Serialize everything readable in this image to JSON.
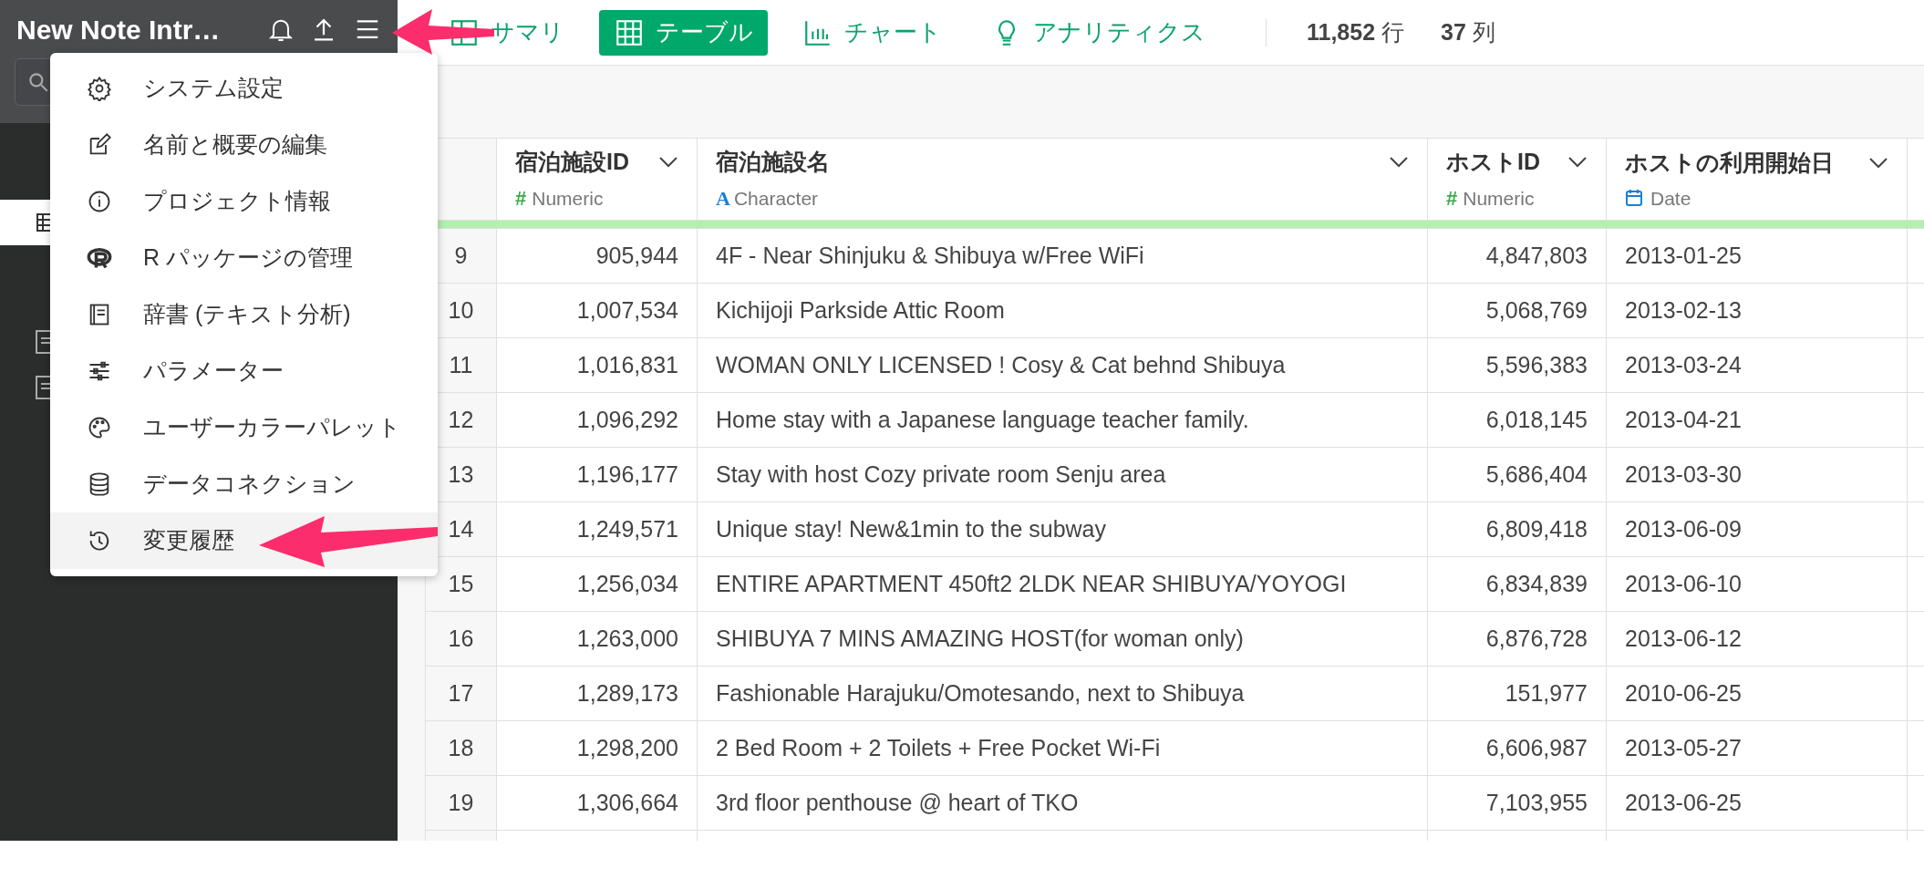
{
  "sidebar": {
    "title": "New Note Intr…"
  },
  "menu": {
    "items": [
      {
        "kind": "gear",
        "label": "システム設定",
        "selected": false
      },
      {
        "kind": "edit",
        "label": "名前と概要の編集",
        "selected": false
      },
      {
        "kind": "info",
        "label": "プロジェクト情報",
        "selected": false
      },
      {
        "kind": "r",
        "label": "R パッケージの管理",
        "selected": false
      },
      {
        "kind": "book",
        "label": "辞書 (テキスト分析)",
        "selected": false
      },
      {
        "kind": "sliders",
        "label": "パラメーター",
        "selected": false
      },
      {
        "kind": "palette",
        "label": "ユーザーカラーパレット",
        "selected": false
      },
      {
        "kind": "database",
        "label": "データコネクション",
        "selected": false
      },
      {
        "kind": "history",
        "label": "変更履歴",
        "selected": true
      }
    ]
  },
  "tabs": [
    {
      "kind": "summary",
      "label": "サマリ",
      "selected": false
    },
    {
      "kind": "table",
      "label": "テーブル",
      "selected": true
    },
    {
      "kind": "chart",
      "label": "チャート",
      "selected": false
    },
    {
      "kind": "analytics",
      "label": "アナリティクス",
      "selected": false
    }
  ],
  "counts": [
    "**11,852** 行",
    "**37** 列"
  ],
  "table": {
    "columns": [
      {
        "name": "宿泊施設ID",
        "kind": "numeric",
        "symbol": "#",
        "type": "Numeric"
      },
      {
        "name": "宿泊施設名",
        "kind": "character",
        "symbol": "A",
        "type": "Character"
      },
      {
        "name": "ホストID",
        "kind": "numeric",
        "symbol": "#",
        "type": "Numeric"
      },
      {
        "name": "ホストの利用開始日",
        "kind": "date",
        "type": "Date"
      }
    ],
    "rows": [
      {
        "number": "9",
        "cells": [
          "905,944",
          "4F - Near Shinjuku & Shibuya w/Free WiFi",
          "4,847,803",
          "2013-01-25"
        ]
      },
      {
        "number": "10",
        "cells": [
          "1,007,534",
          "Kichijoji Parkside Attic Room",
          "5,068,769",
          "2013-02-13"
        ]
      },
      {
        "number": "11",
        "cells": [
          "1,016,831",
          "WOMAN ONLY LICENSED ! Cosy & Cat behnd Shibuya",
          "5,596,383",
          "2013-03-24"
        ]
      },
      {
        "number": "12",
        "cells": [
          "1,096,292",
          "Home stay with a Japanese language teacher family.",
          "6,018,145",
          "2013-04-21"
        ]
      },
      {
        "number": "13",
        "cells": [
          "1,196,177",
          "Stay with host Cozy private room Senju area",
          "5,686,404",
          "2013-03-30"
        ]
      },
      {
        "number": "14",
        "cells": [
          "1,249,571",
          "Unique stay! New&1min to the subway",
          "6,809,418",
          "2013-06-09"
        ]
      },
      {
        "number": "15",
        "cells": [
          "1,256,034",
          "ENTIRE APARTMENT 450ft2 2LDK NEAR SHIBUYA/YOYOGI",
          "6,834,839",
          "2013-06-10"
        ]
      },
      {
        "number": "16",
        "cells": [
          "1,263,000",
          "SHIBUYA 7 MINS AMAZING HOST(for woman only)",
          "6,876,728",
          "2013-06-12"
        ]
      },
      {
        "number": "17",
        "cells": [
          "1,289,173",
          "Fashionable Harajuku/Omotesando, next to Shibuya",
          "151,977",
          "2010-06-25"
        ]
      },
      {
        "number": "18",
        "cells": [
          "1,298,200",
          "2 Bed Room + 2 Toilets + Free Pocket Wi-Fi",
          "6,606,987",
          "2013-05-27"
        ]
      },
      {
        "number": "19",
        "cells": [
          "1,306,664",
          "3rd floor penthouse @ heart of TKO",
          "7,103,955",
          "2013-06-25"
        ]
      }
    ]
  }
}
